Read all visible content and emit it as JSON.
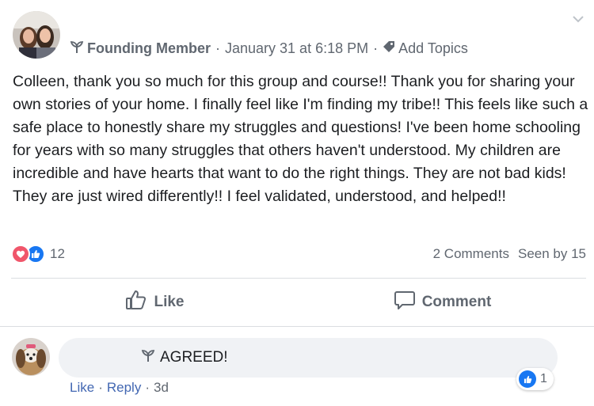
{
  "post": {
    "member_badge": "Founding Member",
    "separator": "·",
    "timestamp": "January 31 at 6:18 PM",
    "add_topics": "Add Topics",
    "body": "Colleen, thank you so much for this group and course!! Thank you for sharing your own stories of your home. I finally feel like I'm finding my tribe!! This feels like such a safe place to honestly share my struggles and questions! I've been home schooling for years with so many struggles that others haven't understood. My children are incredible and have hearts that want to do the right things. They are not bad kids! They are just wired differently!! I feel validated, understood, and helped!!"
  },
  "stats": {
    "reaction_count": "12",
    "comments": "2 Comments",
    "seen_by": "Seen by 15"
  },
  "actions": {
    "like": "Like",
    "comment": "Comment"
  },
  "comment": {
    "text": "AGREED!",
    "reaction_count": "1",
    "like": "Like",
    "reply": "Reply",
    "separator": "·",
    "time": "3d"
  },
  "colors": {
    "love": "#f0566b",
    "like": "#1877f2",
    "link": "#4267b2",
    "muted": "#606770",
    "bubble": "#f0f2f5"
  },
  "icons": [
    "sprout-icon",
    "tag-icon",
    "chevron-down-icon",
    "heart-icon",
    "thumbs-up-icon",
    "speech-bubble-icon"
  ]
}
